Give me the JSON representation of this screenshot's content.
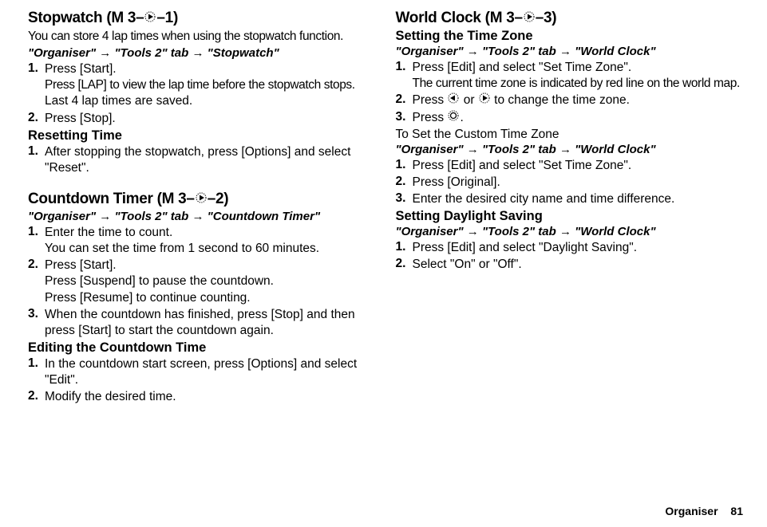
{
  "left": {
    "stopwatch": {
      "title_prefix": "Stopwatch (M 3–",
      "title_suffix": "–1)",
      "intro": "You can store 4 lap times when using the stopwatch function.",
      "path_organiser": "\"Organiser\"",
      "path_tools": "\"Tools 2\" tab",
      "path_dest": "\"Stopwatch\"",
      "steps": [
        {
          "num": "1.",
          "main": "Press [Start].",
          "note1": "Press [LAP] to view the lap time before the stopwatch stops.",
          "note2": "Last 4 lap times are saved."
        },
        {
          "num": "2.",
          "main": "Press [Stop]."
        }
      ],
      "reset_heading": "Resetting Time",
      "reset_steps": [
        {
          "num": "1.",
          "main": "After stopping the stopwatch, press [Options] and select \"Reset\"."
        }
      ]
    },
    "countdown": {
      "title_prefix": "Countdown Timer (M 3–",
      "title_suffix": "–2)",
      "path_organiser": "\"Organiser\"",
      "path_tools": "\"Tools 2\" tab",
      "path_dest": "\"Countdown Timer\"",
      "steps": [
        {
          "num": "1.",
          "main": "Enter the time to count.",
          "note1": "You can set the time from 1 second to 60 minutes."
        },
        {
          "num": "2.",
          "main": "Press [Start].",
          "note1": "Press [Suspend] to pause the countdown.",
          "note2": "Press [Resume] to continue counting."
        },
        {
          "num": "3.",
          "main": "When the countdown has finished, press [Stop] and then press [Start] to start the countdown again."
        }
      ],
      "edit_heading": "Editing the Countdown Time",
      "edit_steps": [
        {
          "num": "1.",
          "main": "In the countdown start screen, press [Options] and select \"Edit\"."
        },
        {
          "num": "2.",
          "main": "Modify the desired time."
        }
      ]
    }
  },
  "right": {
    "worldclock": {
      "title_prefix": "World Clock (M 3–",
      "title_suffix": "–3)",
      "tz_heading": "Setting the Time Zone",
      "path_organiser": "\"Organiser\"",
      "path_tools": "\"Tools 2\" tab",
      "path_dest": "\"World Clock\"",
      "tz_steps": [
        {
          "num": "1.",
          "main": "Press [Edit] and select \"Set Time Zone\".",
          "note1": "The current time zone is indicated by red line on the world map."
        },
        {
          "num": "2.",
          "pre": "Press ",
          "mid": " or ",
          "post": " to change the time zone."
        },
        {
          "num": "3.",
          "pre": "Press ",
          "post": "."
        }
      ],
      "custom_heading": "To Set the Custom Time Zone",
      "custom_steps": [
        {
          "num": "1.",
          "main": "Press [Edit] and select \"Set Time Zone\"."
        },
        {
          "num": "2.",
          "main": "Press [Original]."
        },
        {
          "num": "3.",
          "main": "Enter the desired city name and time difference."
        }
      ],
      "dst_heading": "Setting Daylight Saving",
      "dst_steps": [
        {
          "num": "1.",
          "main": "Press [Edit] and select \"Daylight Saving\"."
        },
        {
          "num": "2.",
          "main": "Select \"On\" or \"Off\"."
        }
      ]
    }
  },
  "footer": {
    "section": "Organiser",
    "page": "81"
  },
  "arrow": "→"
}
